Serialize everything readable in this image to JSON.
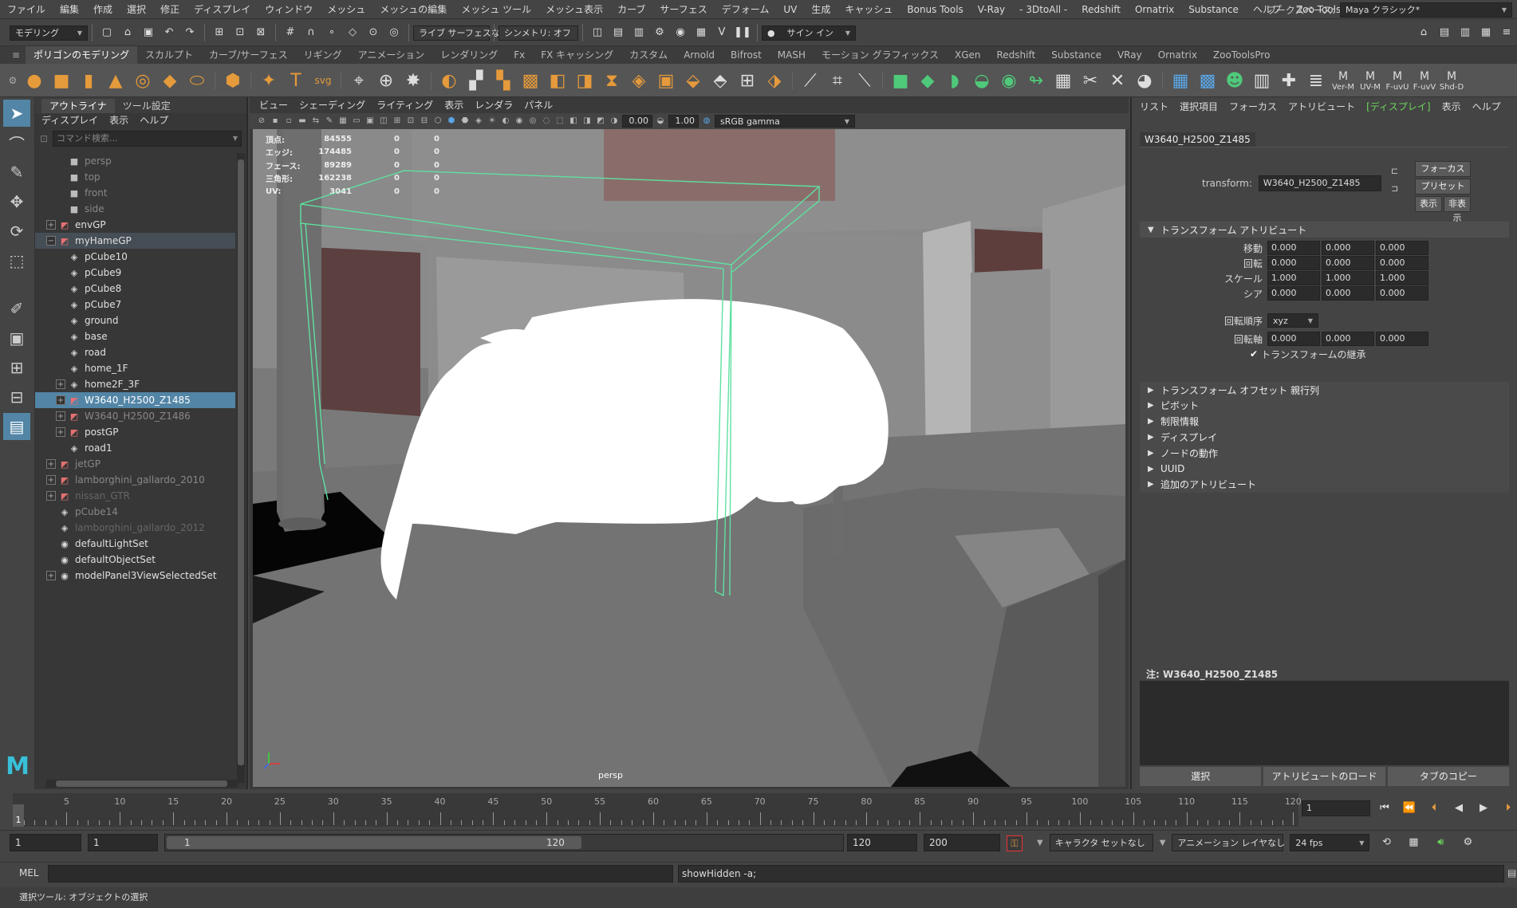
{
  "menubar": {
    "items": [
      "ファイル",
      "編集",
      "作成",
      "選択",
      "修正",
      "ディスプレイ",
      "ウィンドウ",
      "メッシュ",
      "メッシュの編集",
      "メッシュ ツール",
      "メッシュ表示",
      "カーブ",
      "サーフェス",
      "デフォーム",
      "UV",
      "生成",
      "キャッシュ",
      "Bonus Tools",
      "V-Ray",
      "- 3DtoAll -",
      "Redshift",
      "Ornatrix",
      "Substance",
      "ヘルプ",
      "Zoo Tools"
    ],
    "workspace_label": "ワークスペース:",
    "workspace_value": "Maya クラシック*"
  },
  "statusline": {
    "mode": "モデリング",
    "live_surface": "ライブ サーフェスなし",
    "symmetry": "シンメトリ: オフ",
    "signin": "サイン イン"
  },
  "shelf": {
    "tabs": [
      "ポリゴンのモデリング",
      "スカルプト",
      "カーブ/サーフェス",
      "リギング",
      "アニメーション",
      "レンダリング",
      "Fx",
      "FX キャッシング",
      "カスタム",
      "Arnold",
      "Bifrost",
      "MASH",
      "モーション グラフィックス",
      "XGen",
      "Redshift",
      "Substance",
      "VRay",
      "Ornatrix",
      "ZooToolsPro"
    ],
    "active_tab": "ポリゴンのモデリング",
    "text_icons": [
      "Ver-M",
      "UV-M",
      "F-uvU",
      "F-uvV",
      "Shd-D"
    ]
  },
  "outliner": {
    "tabs": [
      "アウトライナ",
      "ツール設定"
    ],
    "menu": [
      "ディスプレイ",
      "表示",
      "ヘルプ"
    ],
    "search_placeholder": "コマンド検索...",
    "nodes": [
      {
        "label": "persp",
        "icon": "camera-icon",
        "depth": 1,
        "exp": false,
        "dim": true
      },
      {
        "label": "top",
        "icon": "camera-icon",
        "depth": 1,
        "exp": false,
        "dim": true
      },
      {
        "label": "front",
        "icon": "camera-icon",
        "depth": 1,
        "exp": false,
        "dim": true
      },
      {
        "label": "side",
        "icon": "camera-icon",
        "depth": 1,
        "exp": false,
        "dim": true
      },
      {
        "label": "envGP",
        "icon": "group-icon",
        "depth": 0,
        "exp": "+",
        "dim": false
      },
      {
        "label": "myHameGP",
        "icon": "group-icon",
        "depth": 0,
        "exp": "-",
        "dim": false,
        "hl": true
      },
      {
        "label": "pCube10",
        "icon": "mesh-icon",
        "depth": 1,
        "exp": false,
        "dim": false
      },
      {
        "label": "pCube9",
        "icon": "mesh-icon",
        "depth": 1,
        "exp": false,
        "dim": false
      },
      {
        "label": "pCube8",
        "icon": "mesh-icon",
        "depth": 1,
        "exp": false,
        "dim": false
      },
      {
        "label": "pCube7",
        "icon": "mesh-icon",
        "depth": 1,
        "exp": false,
        "dim": false
      },
      {
        "label": "ground",
        "icon": "mesh-icon",
        "depth": 1,
        "exp": false,
        "dim": false
      },
      {
        "label": "base",
        "icon": "mesh-icon",
        "depth": 1,
        "exp": false,
        "dim": false
      },
      {
        "label": "road",
        "icon": "mesh-icon",
        "depth": 1,
        "exp": false,
        "dim": false
      },
      {
        "label": "home_1F",
        "icon": "mesh-icon",
        "depth": 1,
        "exp": false,
        "dim": false
      },
      {
        "label": "home2F_3F",
        "icon": "mesh-icon",
        "depth": 1,
        "exp": "+",
        "dim": false
      },
      {
        "label": "W3640_H2500_Z1485",
        "icon": "group-icon",
        "depth": 1,
        "exp": "+",
        "dim": false,
        "sel": true
      },
      {
        "label": "W3640_H2500_Z1486",
        "icon": "group-icon",
        "depth": 1,
        "exp": "+",
        "dim": true
      },
      {
        "label": "postGP",
        "icon": "group-icon",
        "depth": 1,
        "exp": "+",
        "dim": false
      },
      {
        "label": "road1",
        "icon": "mesh-icon",
        "depth": 1,
        "exp": false,
        "dim": false
      },
      {
        "label": "jetGP",
        "icon": "group-icon",
        "depth": 0,
        "exp": "+",
        "dim": true
      },
      {
        "label": "lamborghini_gallardo_2010",
        "icon": "group-icon",
        "depth": 0,
        "exp": "+",
        "dim": true
      },
      {
        "label": "nissan_GTR",
        "icon": "group-icon",
        "depth": 0,
        "exp": "+",
        "dim2": true
      },
      {
        "label": "pCube14",
        "icon": "mesh-icon",
        "depth": 0,
        "exp": false,
        "dim": true
      },
      {
        "label": "lamborghini_gallardo_2012",
        "icon": "mesh-icon",
        "depth": 0,
        "exp": false,
        "dim2": true
      },
      {
        "label": "defaultLightSet",
        "icon": "set-icon",
        "depth": 0,
        "exp": false,
        "dim": false
      },
      {
        "label": "defaultObjectSet",
        "icon": "set-icon",
        "depth": 0,
        "exp": false,
        "dim": false
      },
      {
        "label": "modelPanel3ViewSelectedSet",
        "icon": "set-icon",
        "depth": 0,
        "exp": "+",
        "dim": false
      }
    ]
  },
  "viewport": {
    "menu": [
      "ビュー",
      "シェーディング",
      "ライティング",
      "表示",
      "レンダラ",
      "パネル"
    ],
    "field_a": "0.00",
    "field_b": "1.00",
    "colorspace": "sRGB gamma",
    "camera": "persp",
    "hud": [
      {
        "label": "頂点:",
        "value": "84555",
        "z1": "0",
        "z2": "0"
      },
      {
        "label": "エッジ:",
        "value": "174485",
        "z1": "0",
        "z2": "0"
      },
      {
        "label": "フェース:",
        "value": "89289",
        "z1": "0",
        "z2": "0"
      },
      {
        "label": "三角形:",
        "value": "162238",
        "z1": "0",
        "z2": "0"
      },
      {
        "label": "UV:",
        "value": "3041",
        "z1": "0",
        "z2": "0"
      }
    ]
  },
  "attr": {
    "menu": [
      "リスト",
      "選択項目",
      "フォーカス",
      "アトリビュート",
      "[ディスプレイ]",
      "表示",
      "ヘルプ"
    ],
    "node_tab": "W3640_H2500_Z1485",
    "transform_label": "transform:",
    "transform_value": "W3640_H2500_Z1485",
    "buttons": {
      "focus": "フォーカス",
      "preset": "プリセット",
      "show": "表示",
      "hide": "非表示"
    },
    "section_transform": "トランスフォーム アトリビュート",
    "rows": [
      {
        "label": "移動",
        "v": [
          "0.000",
          "0.000",
          "0.000"
        ]
      },
      {
        "label": "回転",
        "v": [
          "0.000",
          "0.000",
          "0.000"
        ]
      },
      {
        "label": "スケール",
        "v": [
          "1.000",
          "1.000",
          "1.000"
        ]
      },
      {
        "label": "シア",
        "v": [
          "0.000",
          "0.000",
          "0.000"
        ]
      }
    ],
    "rotate_order_label": "回転順序",
    "rotate_order_value": "xyz",
    "rotate_axis_label": "回転軸",
    "rotate_axis_values": [
      "0.000",
      "0.000",
      "0.000"
    ],
    "inherit_label": "トランスフォームの継承",
    "sections": [
      "トランスフォーム オフセット 親行列",
      "ピボット",
      "制限情報",
      "ディスプレイ",
      "ノードの動作",
      "UUID",
      "追加のアトリビュート"
    ],
    "notes_label": "注: W3640_H2500_Z1485",
    "bottom_buttons": [
      "選択",
      "アトリビュートのロード",
      "タブのコピー"
    ]
  },
  "timeline": {
    "ticks": [
      5,
      10,
      15,
      20,
      25,
      30,
      35,
      40,
      45,
      50,
      55,
      60,
      65,
      70,
      75,
      80,
      85,
      90,
      95,
      100,
      105,
      110,
      115,
      120
    ],
    "current": "1",
    "current_field": "1",
    "fps": "24 fps"
  },
  "range": {
    "start": "1",
    "inner_start": "1",
    "slider_start": "1",
    "slider_end": "120",
    "inner_end": "120",
    "end": "200",
    "charset": "キャラクタ セットなし",
    "animlayer": "アニメーション レイヤなし"
  },
  "cmd": {
    "label": "MEL",
    "output": "showHidden -a;"
  },
  "help": {
    "text": "選択ツール: オブジェクトの選択"
  },
  "colors": {
    "accent": "#5285a6",
    "green": "#6bd65b",
    "orange": "#e59a3b",
    "wire": "#5fe0a0"
  }
}
